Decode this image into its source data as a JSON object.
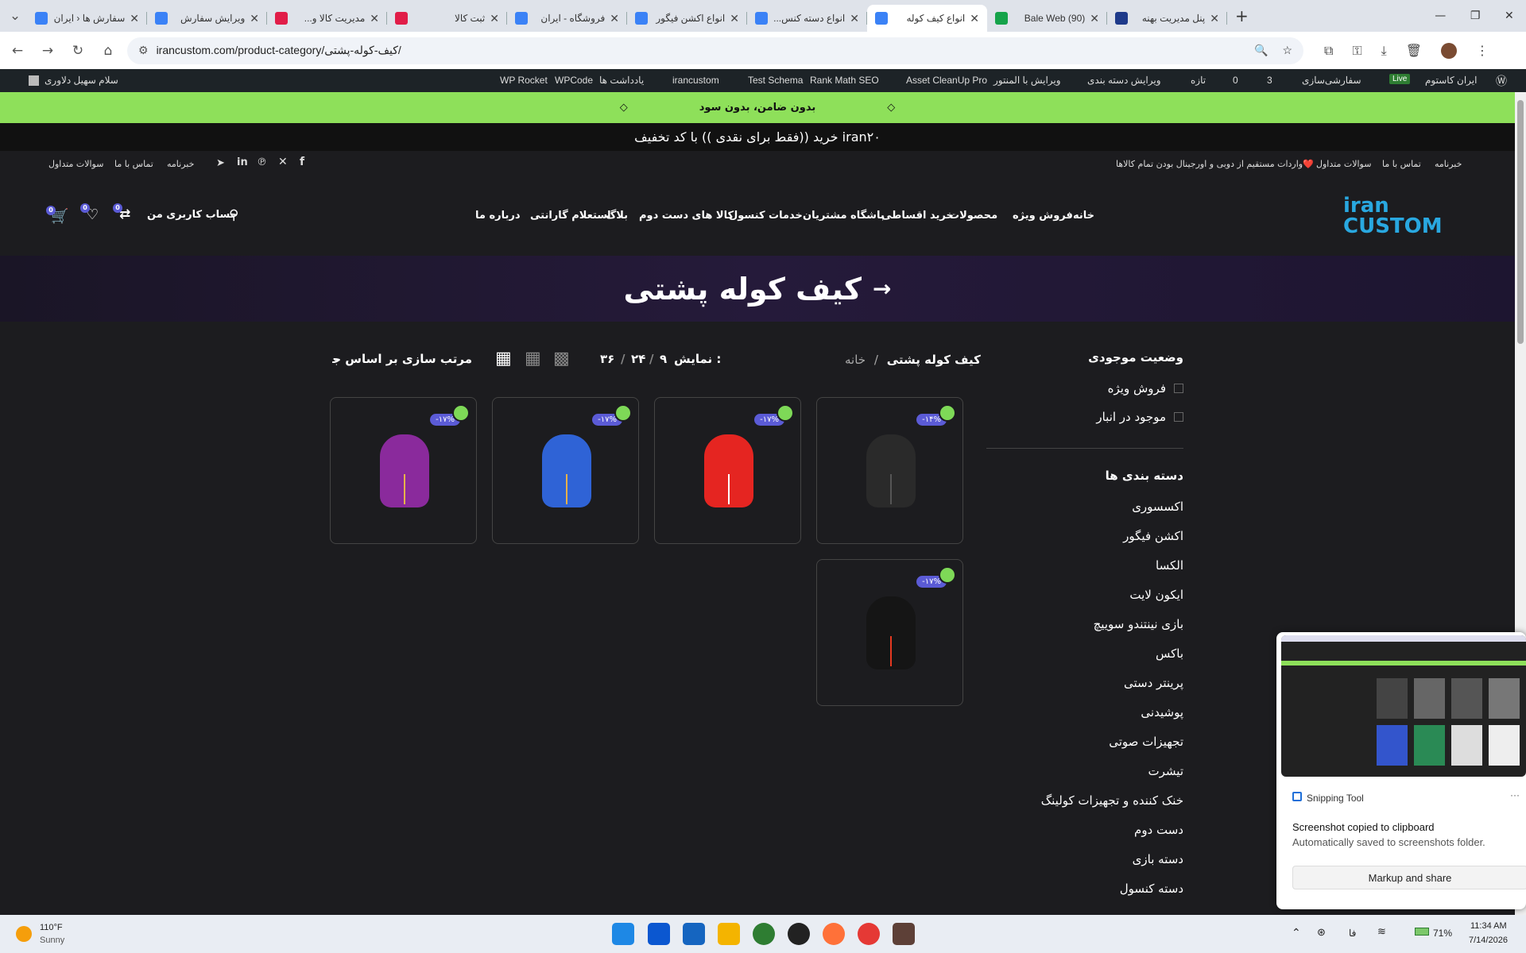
{
  "browser": {
    "tabs": [
      {
        "title": "سفارش ها ‹ ایران",
        "active": false,
        "icon_color": "#3b82f6"
      },
      {
        "title": "ویرایش سفارش",
        "active": false,
        "icon_color": "#3b82f6"
      },
      {
        "title": "مدیریت کالا و...",
        "active": false,
        "icon_color": "#e11d48"
      },
      {
        "title": "ثبت کالا",
        "active": false,
        "icon_color": "#e11d48"
      },
      {
        "title": "فروشگاه - ایران",
        "active": false,
        "icon_color": "#3b82f6"
      },
      {
        "title": "انواع اکشن فیگور",
        "active": false,
        "icon_color": "#3b82f6"
      },
      {
        "title": "انواع دسته کنس...",
        "active": false,
        "icon_color": "#3b82f6"
      },
      {
        "title": "انواع کیف کوله",
        "active": true,
        "icon_color": "#3b82f6"
      },
      {
        "title": "Bale Web (90)",
        "active": false,
        "icon_color": "#16a34a"
      },
      {
        "title": "پنل مدیریت بهنه",
        "active": false,
        "icon_color": "#1e3a8a"
      }
    ],
    "new_tab": "+",
    "url": "irancustom.com/product-category/کیف-کوله-پشتی/"
  },
  "admin_bar": {
    "greeting": "سلام سهیل دلاوری",
    "items": [
      "WP Rocket",
      "WPCode",
      "یادداشت ها",
      "irancustom",
      "Test Schema",
      "Rank Math SEO",
      "Asset CleanUp Pro",
      "ویرایش با المنتور",
      "ویرایش دسته بندی",
      "تازه",
      "0",
      "3",
      "سفارشی‌سازی",
      "Live",
      "ایران کاستوم"
    ]
  },
  "promo": {
    "green": "بدون ضامن، بدون سود",
    "dark": "خرید ((فقط برای نقدی )) با کد تخفیف iran۲۰"
  },
  "top_links_left": [
    "خبرنامه",
    "تماس با ما",
    "سوالات متداول"
  ],
  "top_links_right": [
    "خبرنامه",
    "تماس با ما",
    "سوالات متداول",
    "واردات مستقیم از دوبی و اورجینال بودن تمام کالاها❤️"
  ],
  "logo": {
    "line1": "iran",
    "line2": "CUSTOM"
  },
  "main_nav": [
    "خانه",
    "فروش ویژه",
    "محصولات",
    "خرید اقساطی",
    "باشگاه مشتریان",
    "خدمات کنسول",
    "کالا های دست دوم",
    "بلاگ",
    "استعلام گارانتی",
    "درباره ما"
  ],
  "account": {
    "label": "حساب کاربری من",
    "cart_count": "0",
    "wish_count": "0",
    "compare_count": "0"
  },
  "hero": {
    "title": "کیف کوله پشتی",
    "arrow": "→"
  },
  "breadcrumb": {
    "home": "خانه",
    "sep": "/",
    "current": "کیف کوله پشتی"
  },
  "toolbar": {
    "show_label": "نمایش :",
    "counts": [
      "۹",
      "۲۴",
      "۳۶"
    ],
    "sort": "مرتب سازی بر اساس جدید"
  },
  "filters": {
    "stock_title": "وضعیت موجودی",
    "stock_options": [
      "فروش ویژه",
      "موجود در انبار"
    ],
    "categories_title": "دسته بندی ها",
    "categories": [
      "اکسسوری",
      "اکشن فیگور",
      "الکسا",
      "ایکون لایت",
      "بازی نینتندو سوییچ",
      "باکس",
      "پرینتر دستی",
      "پوشیدنی",
      "تجهیزات صوتی",
      "تیشرت",
      "خنک کننده و تجهیزات کولینگ",
      "دست دوم",
      "دسته بازی",
      "دسته کنسول"
    ]
  },
  "products": [
    {
      "discount": "-۱۴%",
      "color": "#2a2a2a",
      "accent": "#555"
    },
    {
      "discount": "-۱۷%",
      "color": "#e52521",
      "accent": "#fff"
    },
    {
      "discount": "-۱۷%",
      "color": "#2f63d6",
      "accent": "#e7b14a"
    },
    {
      "discount": "-۱۷%",
      "color": "#8a2a9c",
      "accent": "#e7b14a"
    },
    {
      "discount": "-۱۷%",
      "color": "#151515",
      "accent": "#e53920"
    }
  ],
  "snipping": {
    "app": "Snipping Tool",
    "title": "Screenshot copied to clipboard",
    "sub": "Automatically saved to screenshots folder.",
    "button": "Markup and share"
  },
  "taskbar": {
    "temp": "110°F",
    "weather": "Sunny",
    "battery": "71%",
    "lang": "فا",
    "time": "11:34 AM",
    "date": "7/14/2026"
  }
}
